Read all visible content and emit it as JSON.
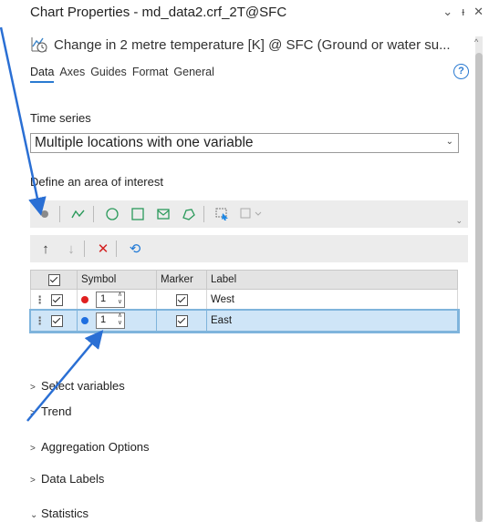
{
  "window": {
    "title": "Chart Properties - md_data2.crf_2T@SFC",
    "chart_title": "Change in  2 metre temperature [K] @ SFC (Ground or water su...",
    "buttons": [
      "⌄",
      "ᵻ",
      "✕"
    ]
  },
  "tabs": [
    {
      "label": "Data",
      "active": true
    },
    {
      "label": "Axes",
      "active": false
    },
    {
      "label": "Guides",
      "active": false
    },
    {
      "label": "Format",
      "active": false
    },
    {
      "label": "General",
      "active": false
    }
  ],
  "help": "?",
  "time_series": {
    "label": "Time series",
    "selected": "Multiple locations with one variable"
  },
  "area_of_interest": {
    "label": "Define an area of interest"
  },
  "table": {
    "columns": [
      "",
      "Symbol",
      "Marker",
      "Label"
    ],
    "rows": [
      {
        "checked": true,
        "color": "#e02020",
        "size": "1",
        "marker": true,
        "label": "West",
        "selected": false
      },
      {
        "checked": true,
        "color": "#1f6fe0",
        "size": "1",
        "marker": true,
        "label": "East",
        "selected": true
      }
    ]
  },
  "sections": [
    {
      "label": "Select variables",
      "expanded": false
    },
    {
      "label": "Trend",
      "expanded": false
    },
    {
      "label": "Aggregation Options",
      "expanded": false
    },
    {
      "label": "Data Labels",
      "expanded": false
    },
    {
      "label": "Statistics",
      "expanded": true
    }
  ],
  "colors": {
    "accent": "#2a7ad1",
    "annotation_arrow": "#2a6fd4",
    "selected_row": "#cfe5f7"
  }
}
